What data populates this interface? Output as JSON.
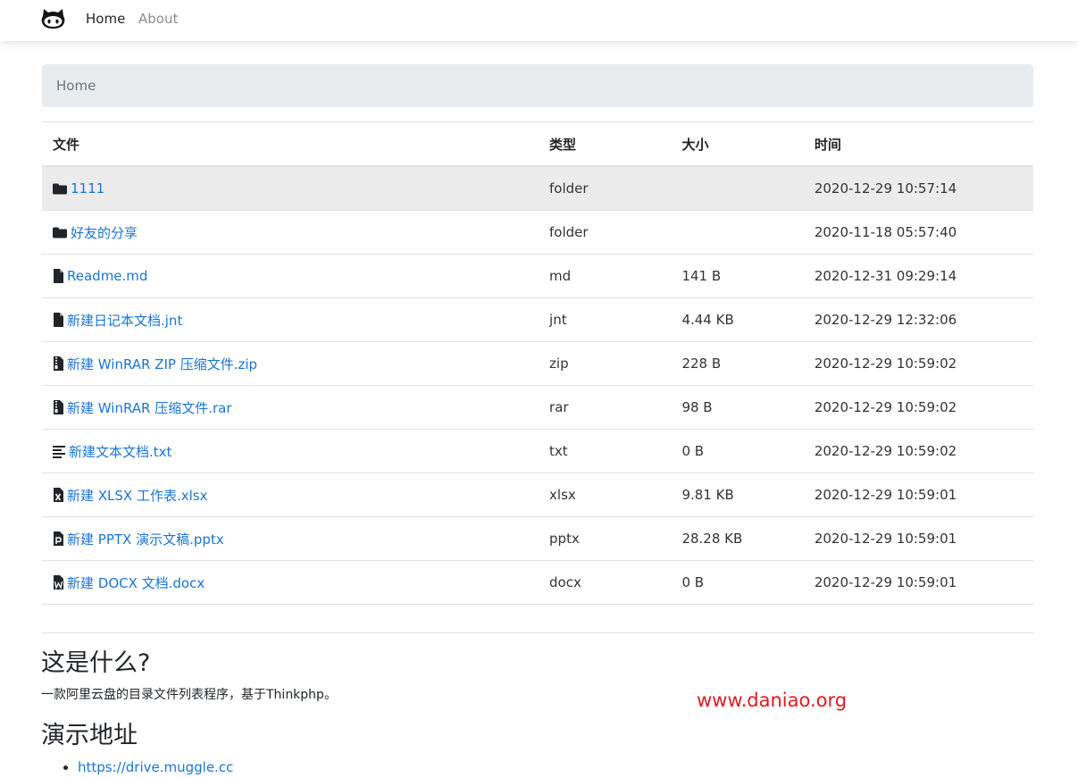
{
  "nav": {
    "home": "Home",
    "about": "About"
  },
  "breadcrumb": {
    "current": "Home"
  },
  "table": {
    "headers": {
      "name": "文件",
      "type": "类型",
      "size": "大小",
      "time": "时间"
    },
    "rows": [
      {
        "icon": "folder-icon",
        "name": "1111",
        "type": "folder",
        "size": "",
        "time": "2020-12-29 10:57:14"
      },
      {
        "icon": "folder-icon",
        "name": "好友的分享",
        "type": "folder",
        "size": "",
        "time": "2020-11-18 05:57:40"
      },
      {
        "icon": "file-icon",
        "name": "Readme.md",
        "type": "md",
        "size": "141 B",
        "time": "2020-12-31 09:29:14"
      },
      {
        "icon": "file-icon",
        "name": "新建日记本文档.jnt",
        "type": "jnt",
        "size": "4.44 KB",
        "time": "2020-12-29 12:32:06"
      },
      {
        "icon": "file-zip-icon",
        "name": "新建 WinRAR ZIP 压缩文件.zip",
        "type": "zip",
        "size": "228 B",
        "time": "2020-12-29 10:59:02"
      },
      {
        "icon": "file-zip-icon",
        "name": "新建 WinRAR 压缩文件.rar",
        "type": "rar",
        "size": "98 B",
        "time": "2020-12-29 10:59:02"
      },
      {
        "icon": "file-text-icon",
        "name": "新建文本文档.txt",
        "type": "txt",
        "size": "0 B",
        "time": "2020-12-29 10:59:02"
      },
      {
        "icon": "file-excel-icon",
        "name": "新建 XLSX 工作表.xlsx",
        "type": "xlsx",
        "size": "9.81 KB",
        "time": "2020-12-29 10:59:01"
      },
      {
        "icon": "file-powerpoint-icon",
        "name": "新建 PPTX 演示文稿.pptx",
        "type": "pptx",
        "size": "28.28 KB",
        "time": "2020-12-29 10:59:01"
      },
      {
        "icon": "file-word-icon",
        "name": "新建 DOCX 文档.docx",
        "type": "docx",
        "size": "0 B",
        "time": "2020-12-29 10:59:01"
      }
    ]
  },
  "readme": {
    "heading_what": "这是什么?",
    "description": "一款阿里云盘的目录文件列表程序，基于Thinkphp。",
    "heading_demo": "演示地址",
    "links": [
      "https://drive.muggle.cc"
    ]
  },
  "watermark": "www.daniao.org",
  "colors": {
    "link": "#1b74d6",
    "watermark": "#e01a22",
    "hover_row": "#ececec",
    "breadcrumb_bg": "#e9ecef"
  }
}
